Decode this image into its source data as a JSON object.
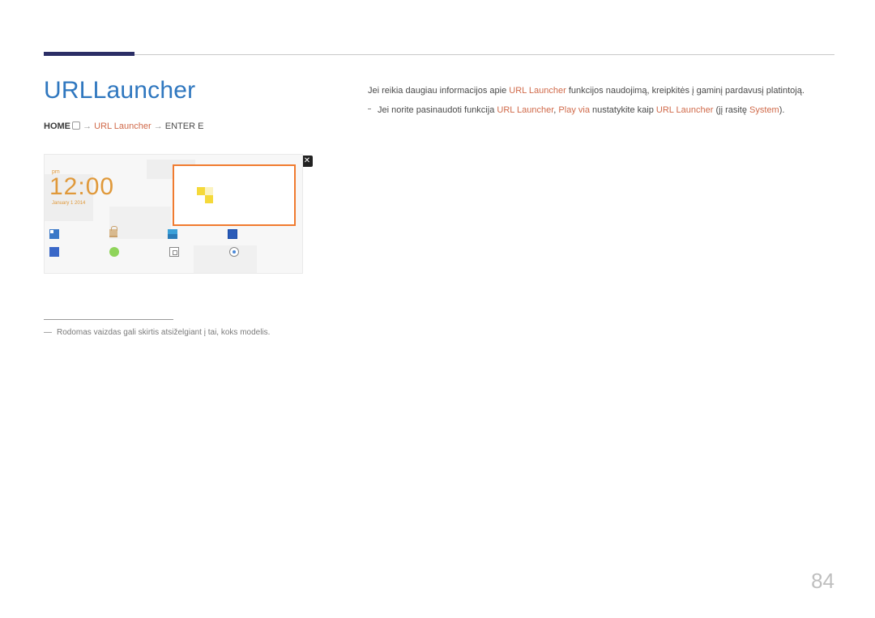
{
  "heading": "URLLauncher",
  "breadcrumb": {
    "home": "HOME",
    "url": "URL Launcher",
    "enter": "ENTER E",
    "sep": "→"
  },
  "panel": {
    "pm": "pm",
    "time": "12:00",
    "date": "January 1 2014",
    "close": "✕"
  },
  "footnote": "Rodomas vaizdas gali skirtis atsiželgiant į tai, koks modelis.",
  "right": {
    "p1a": "Jei reikia daugiau informacijos apie ",
    "p1_hl1": "URL Launcher",
    "p1b": " funkcijos naudojimą, kreipkitės į gaminį pardavusį platintoją.",
    "p2a": "Jei norite pasinaudoti funkcija ",
    "p2_hl1": "URL Launcher",
    "p2_sep": ", ",
    "p2_hl2": "Play via",
    "p2b": " nustatykite kaip ",
    "p2_hl3": "URL Launcher",
    "p2c": " (jį rasitę ",
    "p2_hl4": "System",
    "p2d": ")."
  },
  "page_number": "84"
}
